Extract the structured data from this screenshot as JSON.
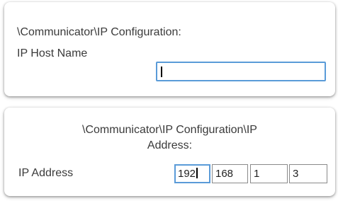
{
  "hostname_panel": {
    "title": "\\Communicator\\IP Configuration:",
    "label": "IP Host Name",
    "input_value": ""
  },
  "ip_panel": {
    "title_line1": "\\Communicator\\IP Configuration\\IP",
    "title_line2": "Address:",
    "label": "IP Address",
    "octets": [
      "192",
      "168",
      "1",
      "3"
    ]
  },
  "colors": {
    "focus_border": "#5a9bd8",
    "text": "#3a3a3a"
  }
}
